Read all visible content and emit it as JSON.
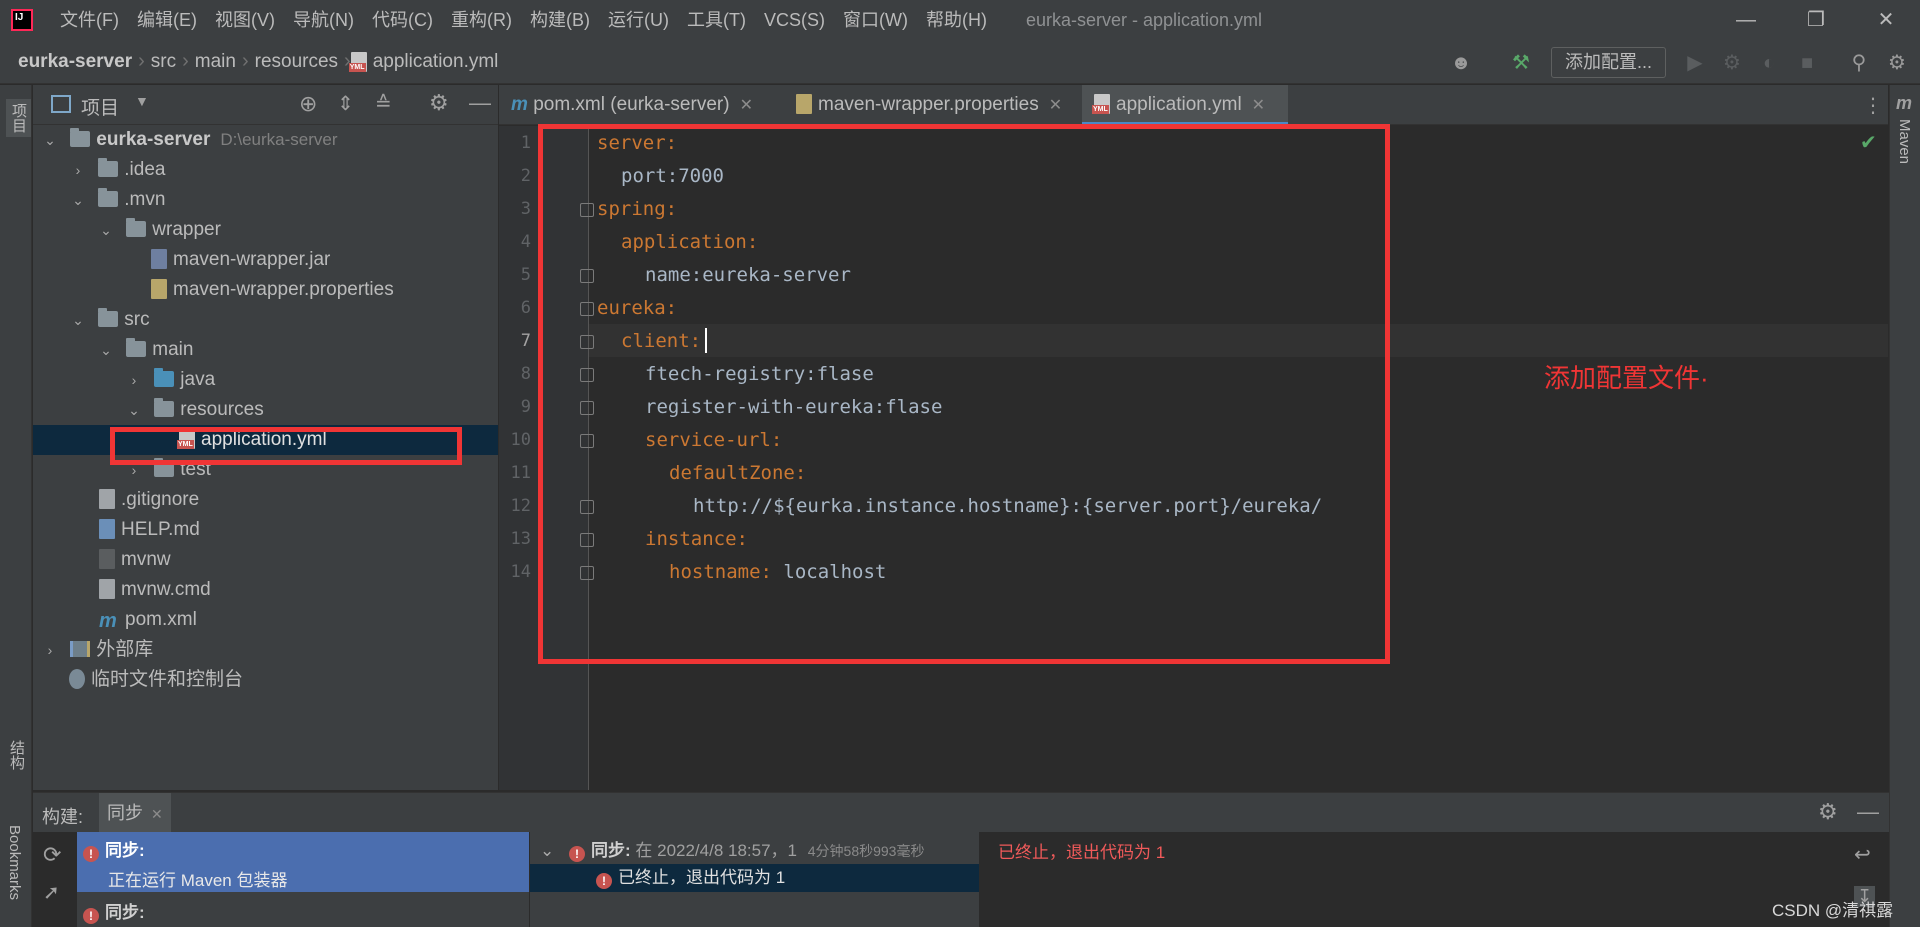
{
  "app": {
    "window_title": "eurka-server - application.yml",
    "menu": [
      "文件(F)",
      "编辑(E)",
      "视图(V)",
      "导航(N)",
      "代码(C)",
      "重构(R)",
      "构建(B)",
      "运行(U)",
      "工具(T)",
      "VCS(S)",
      "窗口(W)",
      "帮助(H)"
    ]
  },
  "breadcrumb": [
    "eurka-server",
    "src",
    "main",
    "resources",
    "application.yml"
  ],
  "toolbar": {
    "add_config_label": "添加配置..."
  },
  "left_strip": {
    "project_label": "项目",
    "structure_label": "结构",
    "bookmarks_label": "Bookmarks"
  },
  "right_strip": {
    "maven_label": "Maven"
  },
  "project_panel": {
    "title": "项目",
    "root": {
      "name": "eurka-server",
      "path": "D:\\eurka-server"
    },
    "items": [
      {
        "label": ".idea"
      },
      {
        "label": ".mvn"
      },
      {
        "label": "wrapper"
      },
      {
        "label": "maven-wrapper.jar"
      },
      {
        "label": "maven-wrapper.properties"
      },
      {
        "label": "src"
      },
      {
        "label": "main"
      },
      {
        "label": "java"
      },
      {
        "label": "resources"
      },
      {
        "label": "application.yml"
      },
      {
        "label": "test"
      },
      {
        "label": ".gitignore"
      },
      {
        "label": "HELP.md"
      },
      {
        "label": "mvnw"
      },
      {
        "label": "mvnw.cmd"
      },
      {
        "label": "pom.xml"
      },
      {
        "label": "外部库"
      },
      {
        "label": "临时文件和控制台"
      }
    ]
  },
  "tabs": [
    {
      "label": "pom.xml (eurka-server)"
    },
    {
      "label": "maven-wrapper.properties"
    },
    {
      "label": "application.yml"
    }
  ],
  "editor": {
    "lines": [
      {
        "no": "1",
        "key": "server",
        "sep": ":",
        "value": ""
      },
      {
        "no": "2",
        "key": "",
        "sep": "",
        "value": "port:7000"
      },
      {
        "no": "3",
        "key": "spring",
        "sep": ":",
        "value": ""
      },
      {
        "no": "4",
        "key": "application",
        "sep": ":",
        "value": ""
      },
      {
        "no": "5",
        "key": "",
        "sep": "",
        "value": "name:eureka-server"
      },
      {
        "no": "6",
        "key": "eureka",
        "sep": ":",
        "value": ""
      },
      {
        "no": "7",
        "key": "client",
        "sep": ":",
        "value": ""
      },
      {
        "no": "8",
        "key": "",
        "sep": "",
        "value": "ftech-registry:flase"
      },
      {
        "no": "9",
        "key": "",
        "sep": "",
        "value": "register-with-eureka:flase"
      },
      {
        "no": "10",
        "key": "service-url",
        "sep": ":",
        "value": ""
      },
      {
        "no": "11",
        "key": "defaultZone",
        "sep": ":",
        "value": ""
      },
      {
        "no": "12",
        "key": "",
        "sep": "",
        "value": "http://${eurka.instance.hostname}:{server.port}/eureka/"
      },
      {
        "no": "13",
        "key": "instance",
        "sep": ":",
        "value": ""
      },
      {
        "no": "14",
        "key": "hostname",
        "sep": ":",
        "value": " localhost"
      }
    ],
    "annotation": "添加配置文件·"
  },
  "build_panel": {
    "label": "构建:",
    "tab": "同步",
    "left_items": [
      {
        "title": "同步:",
        "detail": "正在运行 Maven 包装器"
      },
      {
        "title": "同步:",
        "detail": ""
      }
    ],
    "mid": {
      "title": "同步:",
      "title_rest": "在 2022/4/8 18:57，1",
      "duration": "4分钟58秒993毫秒",
      "child": "已终止，退出代码为 1"
    },
    "console": "已终止，退出代码为 1"
  },
  "watermark": "CSDN @清祺露",
  "colors": {
    "keyword": "#cc7832",
    "value": "#a9b7c6",
    "annotation": "#f03535",
    "selection": "#0d293e",
    "error": "#c75450"
  }
}
